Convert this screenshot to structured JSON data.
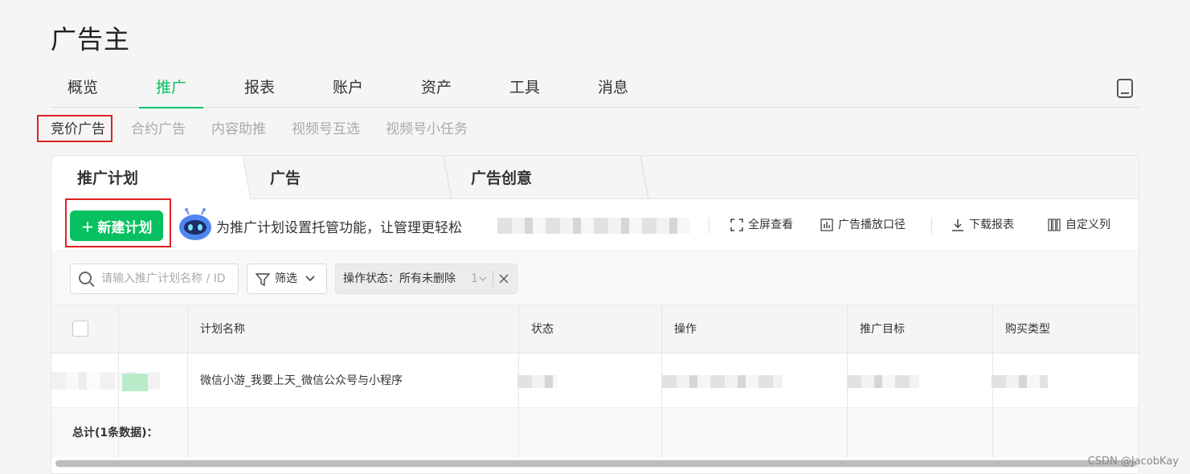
{
  "app": {
    "title": "广告主"
  },
  "main_nav": {
    "tabs": [
      {
        "label": "概览"
      },
      {
        "label": "推广"
      },
      {
        "label": "报表"
      },
      {
        "label": "账户"
      },
      {
        "label": "资产"
      },
      {
        "label": "工具"
      },
      {
        "label": "消息"
      }
    ],
    "active": "推广"
  },
  "sub_nav": {
    "items": [
      {
        "label": "竞价广告"
      },
      {
        "label": "合约广告"
      },
      {
        "label": "内容助推"
      },
      {
        "label": "视频号互选"
      },
      {
        "label": "视频号小任务"
      }
    ],
    "active": "竞价广告"
  },
  "panel_tabs": [
    {
      "label": "推广计划"
    },
    {
      "label": "广告"
    },
    {
      "label": "广告创意"
    }
  ],
  "toolbar": {
    "new_button": "新建计划",
    "hint": "为推广计划设置托管功能，让管理更轻松",
    "tools": [
      {
        "label": "全屏查看",
        "icon": "fullscreen-icon"
      },
      {
        "label": "广告播放口径",
        "icon": "bar-chart-icon"
      },
      {
        "label": "下载报表",
        "icon": "download-icon"
      },
      {
        "label": "自定义列",
        "icon": "columns-icon"
      }
    ]
  },
  "filters": {
    "search_placeholder": "请输入推广计划名称 / ID",
    "filter_label": "筛选",
    "tag": {
      "label": "操作状态：所有未删除",
      "count": "1"
    }
  },
  "table": {
    "columns": [
      "计划名称",
      "状态",
      "操作",
      "推广目标",
      "购买类型"
    ],
    "rows": [
      {
        "name": "微信小游_我要上天_微信公众号与小程序"
      }
    ],
    "footer": "总计(1条数据)："
  },
  "watermark": "CSDN @JacobKay",
  "colors": {
    "accent": "#07c160",
    "highlight_box": "#e02020"
  }
}
